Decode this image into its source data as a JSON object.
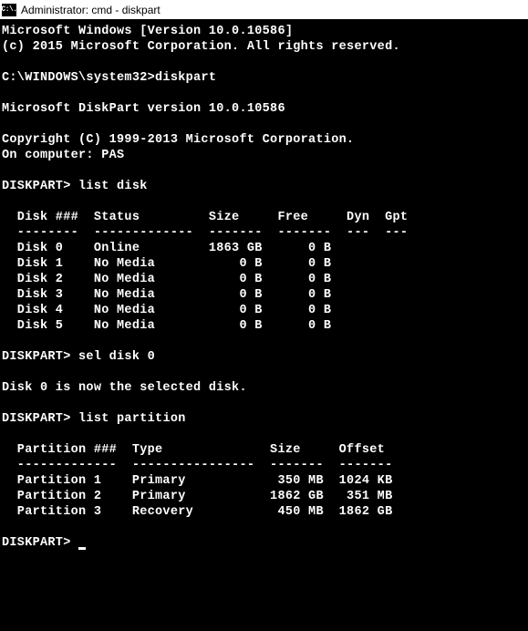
{
  "window": {
    "title": "Administrator: cmd - diskpart",
    "icon_text": "C:\\."
  },
  "banner": {
    "line1": "Microsoft Windows [Version 10.0.10586]",
    "line2": "(c) 2015 Microsoft Corporation. All rights reserved."
  },
  "prompt1": {
    "prefix": "C:\\WINDOWS\\system32>",
    "command": "diskpart"
  },
  "diskpart_banner": {
    "line1": "Microsoft DiskPart version 10.0.10586",
    "line2": "Copyright (C) 1999-2013 Microsoft Corporation.",
    "line3": "On computer: PAS"
  },
  "cmd1": {
    "prefix": "DISKPART>",
    "command": " list disk"
  },
  "disk_table": {
    "header": "  Disk ###  Status         Size     Free     Dyn  Gpt",
    "divider": "  --------  -------------  -------  -------  ---  ---",
    "rows": [
      "  Disk 0    Online         1863 GB      0 B",
      "  Disk 1    No Media           0 B      0 B",
      "  Disk 2    No Media           0 B      0 B",
      "  Disk 3    No Media           0 B      0 B",
      "  Disk 4    No Media           0 B      0 B",
      "  Disk 5    No Media           0 B      0 B"
    ]
  },
  "cmd2": {
    "prefix": "DISKPART>",
    "command": " sel disk 0"
  },
  "response1": "Disk 0 is now the selected disk.",
  "cmd3": {
    "prefix": "DISKPART>",
    "command": " list partition"
  },
  "partition_table": {
    "header": "  Partition ###  Type              Size     Offset",
    "divider": "  -------------  ----------------  -------  -------",
    "rows": [
      "  Partition 1    Primary            350 MB  1024 KB",
      "  Partition 2    Primary           1862 GB   351 MB",
      "  Partition 3    Recovery           450 MB  1862 GB"
    ]
  },
  "cmd4": {
    "prefix": "DISKPART>",
    "command": " "
  }
}
